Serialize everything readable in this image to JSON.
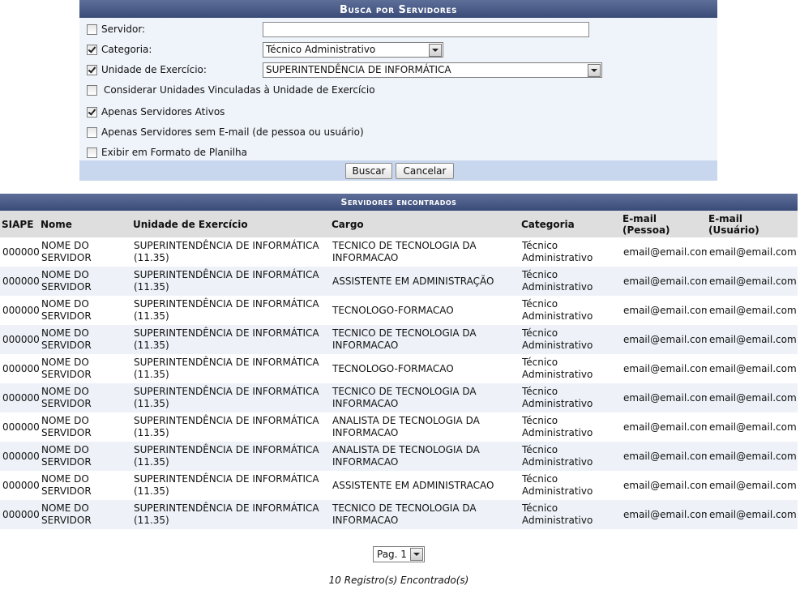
{
  "search": {
    "title": "Busca por Servidores",
    "fields": {
      "servidor": {
        "label": "Servidor:",
        "checked": false,
        "value": ""
      },
      "categoria": {
        "label": "Categoria:",
        "checked": true,
        "value": "Técnico Administrativo"
      },
      "unidade": {
        "label": "Unidade de Exercício:",
        "checked": true,
        "value": "SUPERINTENDÊNCIA DE INFORMÁTICA"
      },
      "vinculadas": {
        "label": "Considerar Unidades Vinculadas à Unidade de Exercício",
        "checked": false
      },
      "ativos": {
        "label": "Apenas Servidores Ativos",
        "checked": true
      },
      "sem_email": {
        "label": "Apenas Servidores sem E-mail (de pessoa ou usuário)",
        "checked": false
      },
      "planilha": {
        "label": "Exibir em Formato de Planilha",
        "checked": false
      }
    },
    "buttons": {
      "buscar": "Buscar",
      "cancelar": "Cancelar"
    }
  },
  "results": {
    "title": "Servidores encontrados",
    "columns": [
      "SIAPE",
      "Nome",
      "Unidade de Exercício",
      "Cargo",
      "Categoria",
      "E-mail (Pessoa)",
      "E-mail (Usuário)"
    ],
    "rows": [
      {
        "siape": "000000",
        "nome": "NOME DO SERVIDOR",
        "unidade": "SUPERINTENDÊNCIA DE INFORMÁTICA (11.35)",
        "cargo": "TECNICO DE TECNOLOGIA DA INFORMACAO",
        "categoria": "Técnico Administrativo",
        "email_pessoa": "email@email.com",
        "email_usuario": "email@email.com"
      },
      {
        "siape": "000000",
        "nome": "NOME DO SERVIDOR",
        "unidade": "SUPERINTENDÊNCIA DE INFORMÁTICA (11.35)",
        "cargo": "ASSISTENTE EM ADMINISTRAÇÃO",
        "categoria": "Técnico Administrativo",
        "email_pessoa": "email@email.com",
        "email_usuario": "email@email.com"
      },
      {
        "siape": "000000",
        "nome": "NOME DO SERVIDOR",
        "unidade": "SUPERINTENDÊNCIA DE INFORMÁTICA (11.35)",
        "cargo": "TECNOLOGO-FORMACAO",
        "categoria": "Técnico Administrativo",
        "email_pessoa": "email@email.com",
        "email_usuario": "email@email.com"
      },
      {
        "siape": "000000",
        "nome": "NOME DO SERVIDOR",
        "unidade": "SUPERINTENDÊNCIA DE INFORMÁTICA (11.35)",
        "cargo": "TECNICO DE TECNOLOGIA DA INFORMACAO",
        "categoria": "Técnico Administrativo",
        "email_pessoa": "email@email.com",
        "email_usuario": "email@email.com"
      },
      {
        "siape": "000000",
        "nome": "NOME DO SERVIDOR",
        "unidade": "SUPERINTENDÊNCIA DE INFORMÁTICA (11.35)",
        "cargo": "TECNOLOGO-FORMACAO",
        "categoria": "Técnico Administrativo",
        "email_pessoa": "email@email.com",
        "email_usuario": "email@email.com"
      },
      {
        "siape": "000000",
        "nome": "NOME DO SERVIDOR",
        "unidade": "SUPERINTENDÊNCIA DE INFORMÁTICA (11.35)",
        "cargo": "TECNICO DE TECNOLOGIA DA INFORMACAO",
        "categoria": "Técnico Administrativo",
        "email_pessoa": "email@email.com",
        "email_usuario": "email@email.com"
      },
      {
        "siape": "000000",
        "nome": "NOME DO SERVIDOR",
        "unidade": "SUPERINTENDÊNCIA DE INFORMÁTICA (11.35)",
        "cargo": "ANALISTA DE TECNOLOGIA DA INFORMACAO",
        "categoria": "Técnico Administrativo",
        "email_pessoa": "email@email.com",
        "email_usuario": "email@email.com"
      },
      {
        "siape": "000000",
        "nome": "NOME DO SERVIDOR",
        "unidade": "SUPERINTENDÊNCIA DE INFORMÁTICA (11.35)",
        "cargo": "ANALISTA DE TECNOLOGIA DA INFORMACAO",
        "categoria": "Técnico Administrativo",
        "email_pessoa": "email@email.com",
        "email_usuario": "email@email.com"
      },
      {
        "siape": "000000",
        "nome": "NOME DO SERVIDOR",
        "unidade": "SUPERINTENDÊNCIA DE INFORMÁTICA (11.35)",
        "cargo": "ASSISTENTE EM ADMINISTRACAO",
        "categoria": "Técnico Administrativo",
        "email_pessoa": "email@email.com",
        "email_usuario": "email@email.com"
      },
      {
        "siape": "000000",
        "nome": "NOME DO SERVIDOR",
        "unidade": "SUPERINTENDÊNCIA DE INFORMÁTICA (11.35)",
        "cargo": "TECNICO DE TECNOLOGIA DA INFORMACAO",
        "categoria": "Técnico Administrativo",
        "email_pessoa": "email@email.com",
        "email_usuario": "email@email.com"
      }
    ]
  },
  "pager": {
    "value": "Pag. 1"
  },
  "record_count": "10 Registro(s) Encontrado(s)"
}
